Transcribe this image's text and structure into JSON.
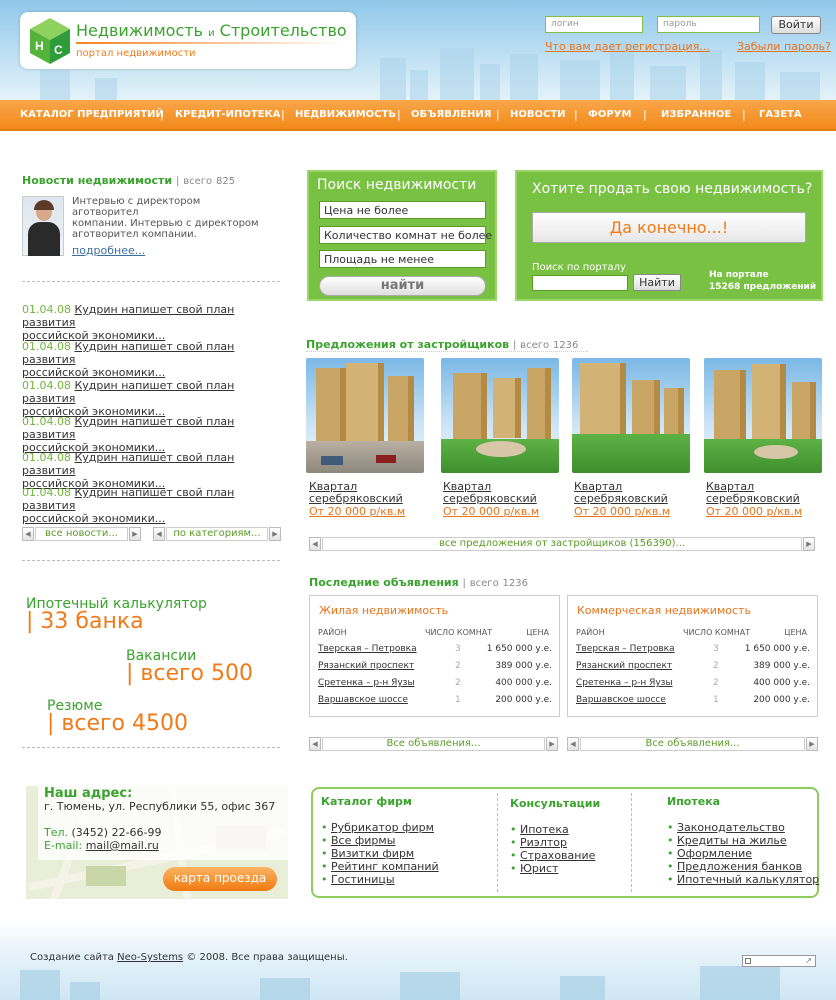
{
  "header": {
    "logo_title": "Недвижимость",
    "logo_and": "и",
    "logo_title2": "Строительство",
    "logo_subtitle": "портал недвижимости",
    "login_placeholder": "логин",
    "password_placeholder": "пароль",
    "login_button": "Войти",
    "register_link": "Что вам дает регистрация...",
    "forgot_link": "Забыли пароль?"
  },
  "nav": [
    "КАТАЛОГ ПРЕДПРИЯТИЙ",
    "КРЕДИТ-ИПОТЕКА",
    "НЕДВИЖИМОСТЬ",
    "ОБЪЯВЛЕНИЯ",
    "НОВОСТИ",
    "ФОРУМ",
    "ИЗБРАННОЕ",
    "ГАЗЕТА"
  ],
  "news": {
    "title": "Новости недвижимости",
    "sep": "|",
    "total_label": "всего",
    "total": "825",
    "interview_line1": "Интервью с директором",
    "interview_line2": "аготворител",
    "interview_line3": "компании. Интервью с директором",
    "interview_line4": "аготворител компании.",
    "more": "подробнее...",
    "items": [
      {
        "date": "01.04.08",
        "text1": "Кудрин напишет свой план развития",
        "text2": "российской экономики..."
      },
      {
        "date": "01.04.08",
        "text1": "Кудрин напишет свой план развития",
        "text2": "российской экономики..."
      },
      {
        "date": "01.04.08",
        "text1": "Кудрин напишет свой план развития",
        "text2": "российской экономики..."
      },
      {
        "date": "01.04.08",
        "text1": "Кудрин напишет свой план развития",
        "text2": "российской экономики..."
      },
      {
        "date": "01.04.08",
        "text1": "Кудрин напишет свой план развития",
        "text2": "российской экономики..."
      },
      {
        "date": "01.04.08",
        "text1": "Кудрин напишет свой план развития",
        "text2": "российской экономики..."
      }
    ],
    "all_news": "все новости...",
    "by_category": "по категориям..."
  },
  "search": {
    "title": "Поиск недвижимости",
    "field1": "Цена не более",
    "field2": "Количество комнат не более",
    "field3": "Площадь не менее",
    "button": "найти"
  },
  "sell": {
    "title": "Хотите продать свою недвижимость?",
    "button": "Да конечно...!",
    "portal_search_label": "Поиск по порталу",
    "portal_search_button": "Найти",
    "stats_line1": "На портале",
    "stats_line2": "15268 предложений"
  },
  "developers": {
    "title": "Предложения от застройщиков",
    "sep": "|",
    "total_label": "всего",
    "total": "1236",
    "items": [
      {
        "name1": "Квартал",
        "name2": "серебряковский",
        "price": "От 20 000 р/кв.м"
      },
      {
        "name1": "Квартал",
        "name2": "серебряковский",
        "price": "От 20 000 р/кв.м"
      },
      {
        "name1": "Квартал",
        "name2": "серебряковский",
        "price": "От 20 000 р/кв.м"
      },
      {
        "name1": "Квартал",
        "name2": "серебряковский",
        "price": "От 20 000 р/кв.м"
      }
    ],
    "all_link": "все предложения от застройщиков (156390)..."
  },
  "ads": {
    "title": "Последние объявления",
    "sep": "|",
    "total_label": "всего",
    "total": "1236",
    "columns": {
      "district": "РАЙОН",
      "rooms": "ЧИСЛО КОМНАТ",
      "price": "ЦЕНА"
    },
    "residential": {
      "title": "Жилая недвижимость",
      "rows": [
        {
          "district": "Тверская – Петровка",
          "rooms": "3",
          "price": "1 650 000 у.е."
        },
        {
          "district": "Рязанский проспект",
          "rooms": "2",
          "price": "389 000 у.е."
        },
        {
          "district": "Сретенка – р-н Яузы",
          "rooms": "2",
          "price": "400 000 у.е."
        },
        {
          "district": "Варшавское шоссе",
          "rooms": "1",
          "price": "200 000 у.е."
        }
      ]
    },
    "commercial": {
      "title": "Коммерческая недвижимость",
      "rows": [
        {
          "district": "Тверская – Петровка",
          "rooms": "3",
          "price": "1 650 000 у.е."
        },
        {
          "district": "Рязанский проспект",
          "rooms": "2",
          "price": "389 000 у.е."
        },
        {
          "district": "Сретенка – р-н Яузы",
          "rooms": "2",
          "price": "400 000 у.е."
        },
        {
          "district": "Варшавское шоссе",
          "rooms": "1",
          "price": "200 000 у.е."
        }
      ]
    },
    "all_link": "Все объявления..."
  },
  "calc": {
    "mortgage_title": "Ипотечный калькулятор",
    "mortgage_value": "| 33 банка",
    "vacancies_title": "Вакансии",
    "vacancies_value": "| всего 500",
    "resume_title": "Резюме",
    "resume_value": "| всего 4500"
  },
  "address": {
    "title": "Наш адрес:",
    "line": "г. Тюмень, ул. Республики 55, офис 367",
    "phone_label": "Тел.",
    "phone": "(3452) 22-66-99",
    "email_label": "E-mail:",
    "email": "mail@mail.ru",
    "map_button": "карта проезда"
  },
  "firms": {
    "catalog_title": "Каталог фирм",
    "catalog": [
      "Рубрикатор фирм",
      "Все фирмы",
      "Визитки фирм",
      "Рейтинг компаний",
      "Гостиницы"
    ],
    "consult_title": "Консультации",
    "consult": [
      "Ипотека",
      "Риэлтор",
      "Страхование",
      "Юрист"
    ],
    "mortgage_title": "Ипотека",
    "mortgage": [
      "Законодательство",
      "Кредиты на жилье",
      "Оформление",
      "Предложения банков",
      "Ипотечный калькулятор"
    ]
  },
  "footer": {
    "prefix": "Создание сайта",
    "link": "Neo-Systems",
    "suffix": "© 2008. Все права защищены."
  },
  "colors": {
    "green": "#3aa32e",
    "orange": "#f27a18",
    "nav_orange": "#f5901f",
    "light_green": "#79c142"
  }
}
